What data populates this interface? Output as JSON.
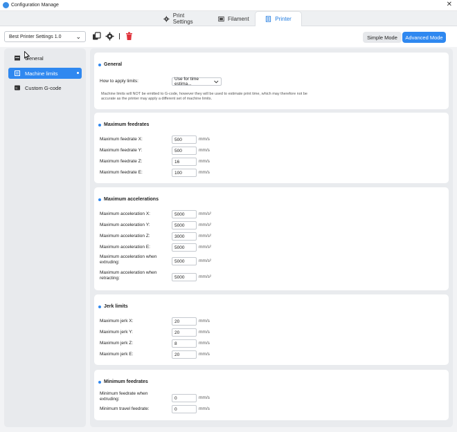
{
  "window": {
    "title": "Configuration Manage",
    "close_glyph": "✕"
  },
  "tabs": [
    {
      "label": "Print Settings",
      "icon": "gear-icon"
    },
    {
      "label": "Filament",
      "icon": "filament-icon"
    },
    {
      "label": "Printer",
      "icon": "printer-icon",
      "active": true
    }
  ],
  "toolbar": {
    "preset": "Best Printer Settings 1.0",
    "preset_chevron": "⌄",
    "separator": "|",
    "simple_mode": "Simple Mode",
    "advanced_mode": "Advanced Mode"
  },
  "sidebar": {
    "items": [
      {
        "label": "General",
        "icon": "list-icon"
      },
      {
        "label": "Machine limits",
        "icon": "limits-icon",
        "active": true
      },
      {
        "label": "Custom G-code",
        "icon": "gcode-icon"
      }
    ]
  },
  "sections": {
    "general": {
      "title": "General",
      "apply_label": "How to apply limits:",
      "apply_value": "Use for time estima...",
      "note": "Machine limits will NOT be emitted to G-code, however they will be used to estimate print time, which may therefore not be accurate as the printer may apply a different set of machine limits."
    },
    "feedrates": {
      "title": "Maximum feedrates",
      "rows": [
        {
          "label": "Maximum feedrate X:",
          "value": "500",
          "unit": "mm/s"
        },
        {
          "label": "Maximum feedrate Y:",
          "value": "500",
          "unit": "mm/s"
        },
        {
          "label": "Maximum feedrate Z:",
          "value": "16",
          "unit": "mm/s"
        },
        {
          "label": "Maximum feedrate E:",
          "value": "100",
          "unit": "mm/s"
        }
      ]
    },
    "accelerations": {
      "title": "Maximum accelerations",
      "rows": [
        {
          "label": "Maximum acceleration X:",
          "value": "5000",
          "unit": "mm/s²"
        },
        {
          "label": "Maximum acceleration Y:",
          "value": "5000",
          "unit": "mm/s²"
        },
        {
          "label": "Maximum acceleration Z:",
          "value": "3000",
          "unit": "mm/s²"
        },
        {
          "label": "Maximum acceleration E:",
          "value": "5000",
          "unit": "mm/s²"
        },
        {
          "label": "Maximum acceleration when extruding:",
          "value": "5000",
          "unit": "mm/s²"
        },
        {
          "label": "Maximum acceleration when retracting:",
          "value": "5000",
          "unit": "mm/s²"
        }
      ]
    },
    "jerk": {
      "title": "Jerk limits",
      "rows": [
        {
          "label": "Maximum jerk X:",
          "value": "20",
          "unit": "mm/s"
        },
        {
          "label": "Maximum jerk Y:",
          "value": "20",
          "unit": "mm/s"
        },
        {
          "label": "Maximum jerk Z:",
          "value": "8",
          "unit": "mm/s"
        },
        {
          "label": "Maximum jerk E:",
          "value": "20",
          "unit": "mm/s"
        }
      ]
    },
    "min_feedrates": {
      "title": "Minimum feedrates",
      "rows": [
        {
          "label": "Minimum feedrate when extruding:",
          "value": "0",
          "unit": "mm/s"
        },
        {
          "label": "Minimum travel feedrate:",
          "value": "0",
          "unit": "mm/s"
        }
      ]
    }
  },
  "colors": {
    "accent": "#2f88f0",
    "delete": "#e0323a"
  }
}
